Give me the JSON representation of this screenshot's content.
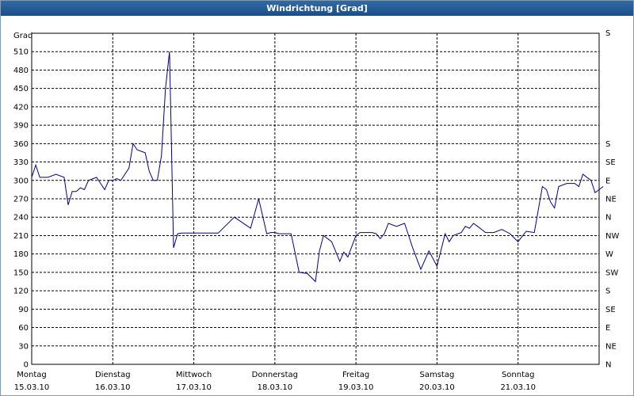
{
  "chart_data": {
    "type": "line",
    "title": "Windrichtung [Grad]",
    "ylabel": "Grad",
    "ylim": [
      0,
      540
    ],
    "yticks": [
      0,
      30,
      60,
      90,
      120,
      150,
      180,
      210,
      240,
      270,
      300,
      330,
      360,
      390,
      420,
      450,
      480,
      510
    ],
    "right_ticks": [
      "N",
      "NE",
      "E",
      "SE",
      "S",
      "SW",
      "W",
      "NW",
      "N",
      "NE",
      "E",
      "SE",
      "S"
    ],
    "right_label_top": "S",
    "xlim": [
      0,
      7
    ],
    "xticks": [
      {
        "day": "Montag",
        "date": "15.03.10"
      },
      {
        "day": "Dienstag",
        "date": "16.03.10"
      },
      {
        "day": "Mittwoch",
        "date": "17.03.10"
      },
      {
        "day": "Donnerstag",
        "date": "18.03.10"
      },
      {
        "day": "Freitag",
        "date": "19.03.10"
      },
      {
        "day": "Samstag",
        "date": "20.03.10"
      },
      {
        "day": "Sonntag",
        "date": "21.03.10"
      }
    ],
    "grid": true,
    "color": "#00008b",
    "series": [
      {
        "x": [
          0,
          0.05,
          0.1,
          0.2,
          0.3,
          0.4,
          0.45,
          0.5,
          0.55,
          0.6,
          0.65,
          0.7,
          0.8,
          0.9,
          0.95,
          1.0,
          1.05,
          1.1,
          1.2,
          1.25,
          1.3,
          1.4,
          1.45,
          1.5,
          1.55,
          1.6,
          1.65,
          1.7,
          1.75,
          1.8,
          1.85,
          1.9,
          1.93,
          1.97,
          1.99,
          2.0,
          2.02,
          2.1,
          2.3,
          2.5,
          2.7,
          2.8,
          2.9,
          2.95,
          3.0,
          3.05,
          3.2,
          3.3,
          3.4,
          3.5,
          3.55,
          3.6,
          3.7,
          3.8,
          3.85,
          3.9,
          4.0,
          4.05,
          4.1,
          4.2,
          4.25,
          4.3,
          4.35,
          4.4,
          4.5,
          4.6,
          4.65,
          4.7,
          4.8,
          4.9,
          5.0,
          5.1,
          5.15,
          5.2,
          5.3,
          5.35,
          5.4,
          5.45,
          5.5,
          5.6,
          5.7,
          5.8,
          5.9,
          6.0,
          6.1,
          6.2,
          6.3,
          6.35,
          6.4,
          6.45,
          6.5,
          6.6,
          6.7,
          6.75,
          6.8,
          6.9,
          6.95,
          7.0,
          7.05
        ],
        "y": [
          305,
          325,
          305,
          305,
          310,
          305,
          260,
          282,
          282,
          288,
          285,
          300,
          305,
          285,
          300,
          300,
          303,
          300,
          320,
          360,
          350,
          345,
          315,
          300,
          300,
          340,
          450,
          510,
          190,
          213,
          214,
          214,
          214,
          214,
          214,
          214,
          214,
          214,
          214,
          240,
          222,
          270,
          213,
          215,
          215,
          213,
          213,
          150,
          148,
          135,
          185,
          210,
          200,
          168,
          183,
          175,
          210,
          215,
          215,
          215,
          213,
          205,
          213,
          230,
          225,
          230,
          210,
          190,
          155,
          185,
          160,
          213,
          200,
          210,
          215,
          225,
          222,
          230,
          225,
          215,
          215,
          220,
          213,
          200,
          217,
          215,
          290,
          285,
          265,
          255,
          290,
          295,
          295,
          290,
          310,
          300,
          280,
          285,
          290
        ]
      }
    ]
  }
}
